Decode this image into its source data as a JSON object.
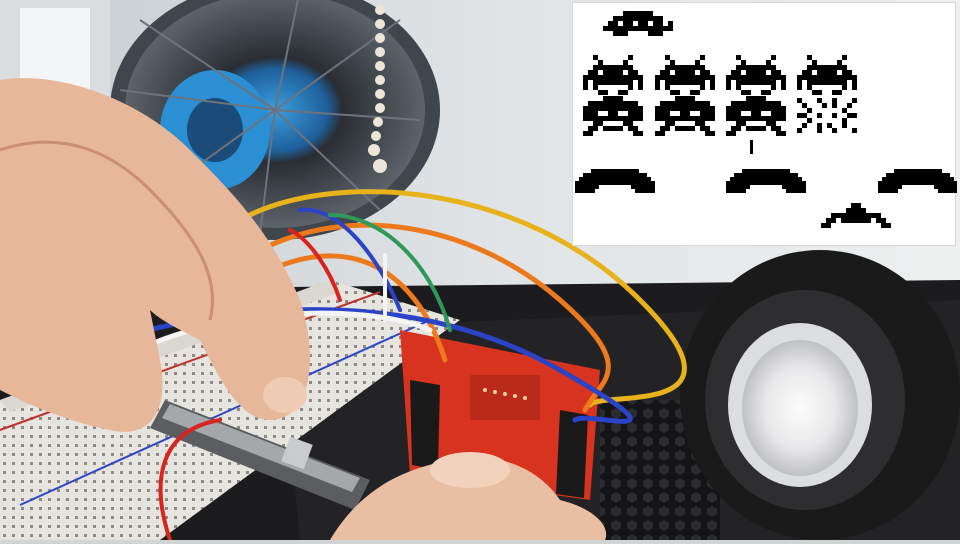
{
  "scene": {
    "subject": "hands-wiring-breadboard-slide-potentiometer",
    "colors": {
      "wall": "#e9ecec",
      "desk": "#1c1c1e",
      "breadboard": "#e6e4de",
      "arduino_board": "#d8331f",
      "wire_red": "#d9231c",
      "wire_yellow": "#e8b21a",
      "wire_orange": "#ec7a1c",
      "wire_blue": "#2a44c8",
      "wire_white": "#f4f4f4",
      "wire_green": "#2f9a58",
      "skin": "#e7b79a",
      "speaker": "#1a1a1a",
      "fan_blue": "#3a9ee0"
    }
  },
  "inset": {
    "background": "#ffffff",
    "sprite_color": "#000000",
    "sprites": [
      "ufo-icon",
      "invader-icon",
      "explosion-icon",
      "bunker-icon",
      "laser-cannon-icon"
    ],
    "invader_grid": {
      "rows": 2,
      "columns": 4,
      "destroyed": 1
    },
    "bunker_count": 3
  }
}
